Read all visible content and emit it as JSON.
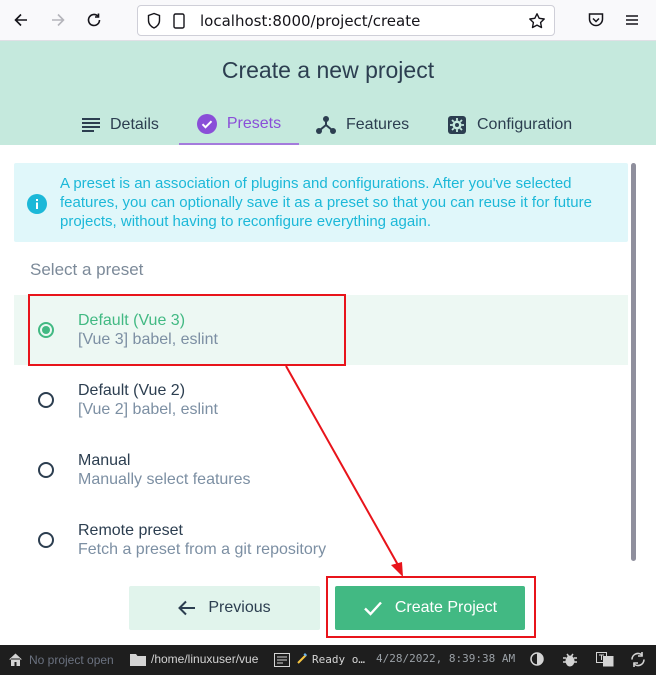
{
  "browser": {
    "url": "localhost:8000/project/create"
  },
  "header": {
    "title": "Create a new project",
    "tabs": [
      {
        "label": "Details"
      },
      {
        "label": "Presets"
      },
      {
        "label": "Features"
      },
      {
        "label": "Configuration"
      }
    ],
    "active_tab": "Presets"
  },
  "info": {
    "text": "A preset is an association of plugins and configurations. After you've selected features, you can optionally save it as a preset so that you can reuse it for future projects, without having to reconfigure everything again."
  },
  "presets": {
    "label": "Select a preset",
    "items": [
      {
        "name": "Default (Vue 3)",
        "desc": "[Vue 3] babel, eslint",
        "selected": true
      },
      {
        "name": "Default (Vue 2)",
        "desc": "[Vue 2] babel, eslint",
        "selected": false
      },
      {
        "name": "Manual",
        "desc": "Manually select features",
        "selected": false
      },
      {
        "name": "Remote preset",
        "desc": "Fetch a preset from a git repository",
        "selected": false
      }
    ]
  },
  "actions": {
    "previous": "Previous",
    "create": "Create Project"
  },
  "statusbar": {
    "project": "No project open",
    "folder": "/home/linuxuser/vue",
    "log": "Ready o…",
    "time": "4/28/2022, 8:39:38 AM"
  },
  "colors": {
    "accent_green": "#42b983",
    "header_bg": "#c5e9dd",
    "active_tab": "#8a4ed8",
    "info_bg": "#e0f7fa",
    "annotation": "#e8141b"
  }
}
